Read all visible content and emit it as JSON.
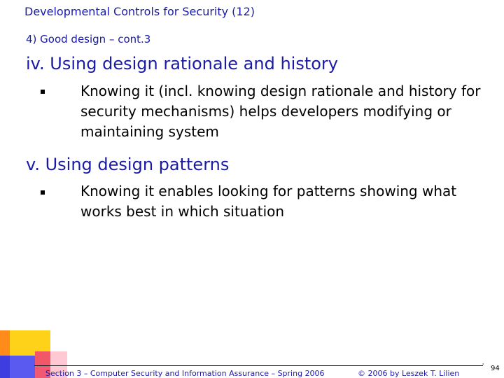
{
  "slide": {
    "title": "Developmental Controls for Security (12)",
    "subtitle": "4) Good design – cont.3"
  },
  "sections": [
    {
      "number": "iv.",
      "heading_plain": "Using ",
      "heading_accent": "design rationale and history",
      "bullet": "Knowing it (incl. knowing design rationale and history for security mechanisms) helps developers modifying or maintaining system"
    },
    {
      "number": "v.",
      "heading_plain": "Using ",
      "heading_accent": "design patterns",
      "bullet": "Knowing it enables looking for patterns showing what works best in which situation"
    }
  ],
  "footer": {
    "left": "Section 3 – Computer Security and Information Assurance – Spring 2006",
    "middle": "© 2006 by Leszek T. Lilien",
    "page_number": "94",
    "tick": "'"
  },
  "colors": {
    "title_blue": "#1a1aa6",
    "accent_blue": "#1a1aa6",
    "text": "#000000"
  }
}
